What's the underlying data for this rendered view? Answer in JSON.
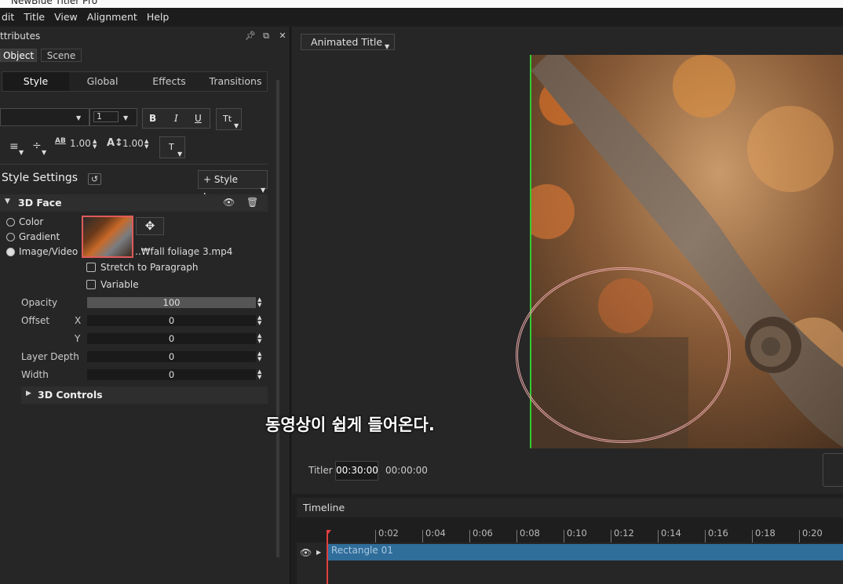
{
  "window": {
    "title": "NewBlue Titler Pro"
  },
  "menu": [
    "dit",
    "Title",
    "View",
    "Alignment",
    "Help"
  ],
  "attributes_panel": {
    "title": "ttributes",
    "tabs": [
      "Object",
      "Scene"
    ],
    "subtabs": [
      "Style",
      "Global",
      "Effects",
      "Transitions"
    ],
    "font_size": "1",
    "format_buttons": {
      "bold": "B",
      "italic": "I",
      "underline": "U",
      "text_case": "Tt",
      "text_type": "T"
    },
    "kerning_label": "AB",
    "kerning_value": "1.00",
    "leading_value": "1.00",
    "style_settings_title": "Style Settings",
    "style_layer_button": "+ Style Layer",
    "face_section": "3D Face",
    "fill_options": [
      "Color",
      "Gradient",
      "Image/Video"
    ],
    "selected_fill": "Image/Video",
    "file_name": "..₩fall foliage 3.mp4",
    "stretch_label": "Stretch to Paragraph",
    "variable_label": "Variable",
    "opacity_label": "Opacity",
    "opacity_value": "100",
    "offset_label": "Offset",
    "x_label": "X",
    "y_label": "Y",
    "offset_x": "0",
    "offset_y": "0",
    "layer_depth_label": "Layer Depth",
    "layer_depth": "0",
    "width_label": "Width",
    "width_value": "0",
    "controls_section": "3D Controls"
  },
  "preview": {
    "preset_dropdown": "Animated Title",
    "caption": "동영상이 쉽게 들어온다."
  },
  "titler_bar": {
    "label": "Titler",
    "duration": "00:30:00",
    "current_time": "00:00:00"
  },
  "timeline": {
    "title": "Timeline",
    "ticks": [
      "0:02",
      "0:04",
      "0:06",
      "0:08",
      "0:10",
      "0:12",
      "0:14",
      "0:16",
      "0:18",
      "0:20"
    ],
    "track_label": "Rectangle 01"
  },
  "colors": {
    "accent_green": "#33cc33",
    "playhead_red": "#e04040",
    "track_blue": "#2f6d9a",
    "highlight_red": "#e05a5a"
  }
}
